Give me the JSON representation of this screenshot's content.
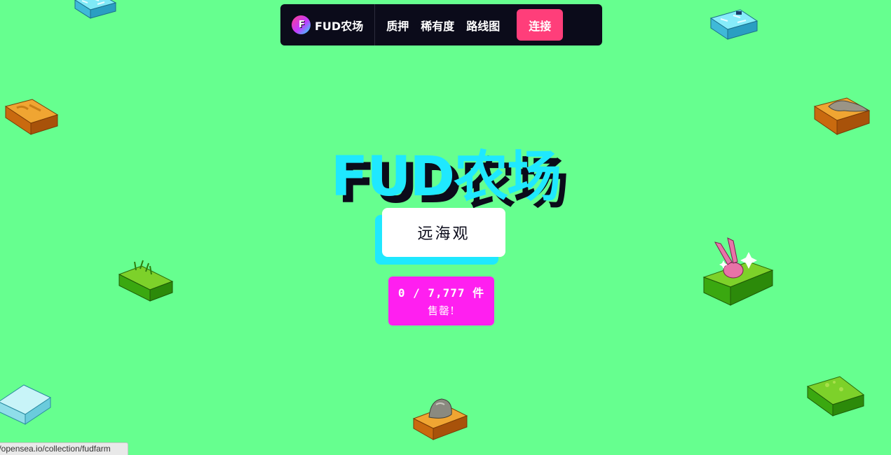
{
  "nav": {
    "brand": "FUD农场",
    "logo_glyph": "F",
    "links": [
      "质押",
      "稀有度",
      "路线图"
    ],
    "connect_label": "连接"
  },
  "hero": {
    "title": "FUD农场",
    "opensea_button_label": "远海观",
    "counter_line1": "0 / 7,777 件",
    "counter_line2": "售罄!"
  },
  "status_bar": {
    "url": "//opensea.io/collection/fudfarm"
  },
  "colors": {
    "background": "#66ff8f",
    "nav_bg": "#0b0b1a",
    "accent_cyan": "#1fe8ff",
    "connect_pink": "#ff3e7a",
    "counter_magenta": "#ff1ff0"
  },
  "decor_blocks": [
    "ice-block",
    "ice-block",
    "dirt-block",
    "dirt-rock-block",
    "grass-block",
    "bunny-grass-block",
    "ice-block",
    "rock-dirt-block",
    "grass-block"
  ]
}
